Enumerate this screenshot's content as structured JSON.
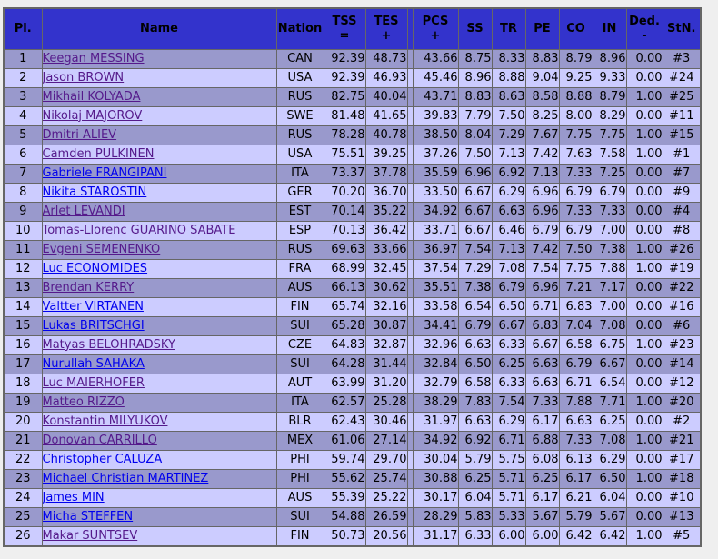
{
  "table": {
    "columns": [
      {
        "key": "pl",
        "label": "Pl.",
        "sign": ""
      },
      {
        "key": "name",
        "label": "Name",
        "sign": ""
      },
      {
        "key": "nation",
        "label": "Nation",
        "sign": ""
      },
      {
        "key": "tss",
        "label": "TSS",
        "sign": "="
      },
      {
        "key": "tes",
        "label": "TES",
        "sign": "+"
      },
      {
        "key": "pcs",
        "label": "PCS",
        "sign": "+"
      },
      {
        "key": "ss",
        "label": "SS",
        "sign": ""
      },
      {
        "key": "tr",
        "label": "TR",
        "sign": ""
      },
      {
        "key": "pe",
        "label": "PE",
        "sign": ""
      },
      {
        "key": "co",
        "label": "CO",
        "sign": ""
      },
      {
        "key": "in",
        "label": "IN",
        "sign": ""
      },
      {
        "key": "ded",
        "label": "Ded.",
        "sign": "-"
      },
      {
        "key": "stn",
        "label": "StN.",
        "sign": ""
      }
    ],
    "rows": [
      {
        "pl": "1",
        "name": "Keegan MESSING",
        "link_state": "visited",
        "nation": "CAN",
        "tss": "92.39",
        "tes": "48.73",
        "pcs": "43.66",
        "ss": "8.75",
        "tr": "8.33",
        "pe": "8.83",
        "co": "8.79",
        "in": "8.96",
        "ded": "0.00",
        "stn": "#3"
      },
      {
        "pl": "2",
        "name": "Jason BROWN",
        "link_state": "visited",
        "nation": "USA",
        "tss": "92.39",
        "tes": "46.93",
        "pcs": "45.46",
        "ss": "8.96",
        "tr": "8.88",
        "pe": "9.04",
        "co": "9.25",
        "in": "9.33",
        "ded": "0.00",
        "stn": "#24"
      },
      {
        "pl": "3",
        "name": "Mikhail KOLYADA",
        "link_state": "visited",
        "nation": "RUS",
        "tss": "82.75",
        "tes": "40.04",
        "pcs": "43.71",
        "ss": "8.83",
        "tr": "8.63",
        "pe": "8.58",
        "co": "8.88",
        "in": "8.79",
        "ded": "1.00",
        "stn": "#25"
      },
      {
        "pl": "4",
        "name": "Nikolaj MAJOROV",
        "link_state": "visited",
        "nation": "SWE",
        "tss": "81.48",
        "tes": "41.65",
        "pcs": "39.83",
        "ss": "7.79",
        "tr": "7.50",
        "pe": "8.25",
        "co": "8.00",
        "in": "8.29",
        "ded": "0.00",
        "stn": "#11"
      },
      {
        "pl": "5",
        "name": "Dmitri ALIEV",
        "link_state": "visited",
        "nation": "RUS",
        "tss": "78.28",
        "tes": "40.78",
        "pcs": "38.50",
        "ss": "8.04",
        "tr": "7.29",
        "pe": "7.67",
        "co": "7.75",
        "in": "7.75",
        "ded": "1.00",
        "stn": "#15"
      },
      {
        "pl": "6",
        "name": "Camden PULKINEN",
        "link_state": "visited",
        "nation": "USA",
        "tss": "75.51",
        "tes": "39.25",
        "pcs": "37.26",
        "ss": "7.50",
        "tr": "7.13",
        "pe": "7.42",
        "co": "7.63",
        "in": "7.58",
        "ded": "1.00",
        "stn": "#1"
      },
      {
        "pl": "7",
        "name": "Gabriele FRANGIPANI",
        "link_state": "unvisited",
        "nation": "ITA",
        "tss": "73.37",
        "tes": "37.78",
        "pcs": "35.59",
        "ss": "6.96",
        "tr": "6.92",
        "pe": "7.13",
        "co": "7.33",
        "in": "7.25",
        "ded": "0.00",
        "stn": "#7"
      },
      {
        "pl": "8",
        "name": "Nikita STAROSTIN",
        "link_state": "unvisited",
        "nation": "GER",
        "tss": "70.20",
        "tes": "36.70",
        "pcs": "33.50",
        "ss": "6.67",
        "tr": "6.29",
        "pe": "6.96",
        "co": "6.79",
        "in": "6.79",
        "ded": "0.00",
        "stn": "#9"
      },
      {
        "pl": "9",
        "name": "Arlet LEVANDI",
        "link_state": "visited",
        "nation": "EST",
        "tss": "70.14",
        "tes": "35.22",
        "pcs": "34.92",
        "ss": "6.67",
        "tr": "6.63",
        "pe": "6.96",
        "co": "7.33",
        "in": "7.33",
        "ded": "0.00",
        "stn": "#4"
      },
      {
        "pl": "10",
        "name": "Tomas-Llorenc GUARINO SABATE",
        "link_state": "visited",
        "nation": "ESP",
        "tss": "70.13",
        "tes": "36.42",
        "pcs": "33.71",
        "ss": "6.67",
        "tr": "6.46",
        "pe": "6.79",
        "co": "6.79",
        "in": "7.00",
        "ded": "0.00",
        "stn": "#8"
      },
      {
        "pl": "11",
        "name": "Evgeni SEMENENKO",
        "link_state": "visited",
        "nation": "RUS",
        "tss": "69.63",
        "tes": "33.66",
        "pcs": "36.97",
        "ss": "7.54",
        "tr": "7.13",
        "pe": "7.42",
        "co": "7.50",
        "in": "7.38",
        "ded": "1.00",
        "stn": "#26"
      },
      {
        "pl": "12",
        "name": "Luc ECONOMIDES",
        "link_state": "unvisited",
        "nation": "FRA",
        "tss": "68.99",
        "tes": "32.45",
        "pcs": "37.54",
        "ss": "7.29",
        "tr": "7.08",
        "pe": "7.54",
        "co": "7.75",
        "in": "7.88",
        "ded": "1.00",
        "stn": "#19"
      },
      {
        "pl": "13",
        "name": "Brendan KERRY",
        "link_state": "visited",
        "nation": "AUS",
        "tss": "66.13",
        "tes": "30.62",
        "pcs": "35.51",
        "ss": "7.38",
        "tr": "6.79",
        "pe": "6.96",
        "co": "7.21",
        "in": "7.17",
        "ded": "0.00",
        "stn": "#22"
      },
      {
        "pl": "14",
        "name": "Valtter VIRTANEN",
        "link_state": "unvisited",
        "nation": "FIN",
        "tss": "65.74",
        "tes": "32.16",
        "pcs": "33.58",
        "ss": "6.54",
        "tr": "6.50",
        "pe": "6.71",
        "co": "6.83",
        "in": "7.00",
        "ded": "0.00",
        "stn": "#16"
      },
      {
        "pl": "15",
        "name": "Lukas BRITSCHGI",
        "link_state": "unvisited",
        "nation": "SUI",
        "tss": "65.28",
        "tes": "30.87",
        "pcs": "34.41",
        "ss": "6.79",
        "tr": "6.67",
        "pe": "6.83",
        "co": "7.04",
        "in": "7.08",
        "ded": "0.00",
        "stn": "#6"
      },
      {
        "pl": "16",
        "name": "Matyas BELOHRADSKY",
        "link_state": "visited",
        "nation": "CZE",
        "tss": "64.83",
        "tes": "32.87",
        "pcs": "32.96",
        "ss": "6.63",
        "tr": "6.33",
        "pe": "6.67",
        "co": "6.58",
        "in": "6.75",
        "ded": "1.00",
        "stn": "#23"
      },
      {
        "pl": "17",
        "name": "Nurullah SAHAKA",
        "link_state": "unvisited",
        "nation": "SUI",
        "tss": "64.28",
        "tes": "31.44",
        "pcs": "32.84",
        "ss": "6.50",
        "tr": "6.25",
        "pe": "6.63",
        "co": "6.79",
        "in": "6.67",
        "ded": "0.00",
        "stn": "#14"
      },
      {
        "pl": "18",
        "name": "Luc MAIERHOFER",
        "link_state": "visited",
        "nation": "AUT",
        "tss": "63.99",
        "tes": "31.20",
        "pcs": "32.79",
        "ss": "6.58",
        "tr": "6.33",
        "pe": "6.63",
        "co": "6.71",
        "in": "6.54",
        "ded": "0.00",
        "stn": "#12"
      },
      {
        "pl": "19",
        "name": "Matteo RIZZO",
        "link_state": "visited",
        "nation": "ITA",
        "tss": "62.57",
        "tes": "25.28",
        "pcs": "38.29",
        "ss": "7.83",
        "tr": "7.54",
        "pe": "7.33",
        "co": "7.88",
        "in": "7.71",
        "ded": "1.00",
        "stn": "#20"
      },
      {
        "pl": "20",
        "name": "Konstantin MILYUKOV",
        "link_state": "visited",
        "nation": "BLR",
        "tss": "62.43",
        "tes": "30.46",
        "pcs": "31.97",
        "ss": "6.63",
        "tr": "6.29",
        "pe": "6.17",
        "co": "6.63",
        "in": "6.25",
        "ded": "0.00",
        "stn": "#2"
      },
      {
        "pl": "21",
        "name": "Donovan CARRILLO",
        "link_state": "visited",
        "nation": "MEX",
        "tss": "61.06",
        "tes": "27.14",
        "pcs": "34.92",
        "ss": "6.92",
        "tr": "6.71",
        "pe": "6.88",
        "co": "7.33",
        "in": "7.08",
        "ded": "1.00",
        "stn": "#21"
      },
      {
        "pl": "22",
        "name": "Christopher CALUZA",
        "link_state": "unvisited",
        "nation": "PHI",
        "tss": "59.74",
        "tes": "29.70",
        "pcs": "30.04",
        "ss": "5.79",
        "tr": "5.75",
        "pe": "6.08",
        "co": "6.13",
        "in": "6.29",
        "ded": "0.00",
        "stn": "#17"
      },
      {
        "pl": "23",
        "name": "Michael Christian MARTINEZ",
        "link_state": "unvisited",
        "nation": "PHI",
        "tss": "55.62",
        "tes": "25.74",
        "pcs": "30.88",
        "ss": "6.25",
        "tr": "5.71",
        "pe": "6.25",
        "co": "6.17",
        "in": "6.50",
        "ded": "1.00",
        "stn": "#18"
      },
      {
        "pl": "24",
        "name": "James MIN",
        "link_state": "unvisited",
        "nation": "AUS",
        "tss": "55.39",
        "tes": "25.22",
        "pcs": "30.17",
        "ss": "6.04",
        "tr": "5.71",
        "pe": "6.17",
        "co": "6.21",
        "in": "6.04",
        "ded": "0.00",
        "stn": "#10"
      },
      {
        "pl": "25",
        "name": "Micha STEFFEN",
        "link_state": "unvisited",
        "nation": "SUI",
        "tss": "54.88",
        "tes": "26.59",
        "pcs": "28.29",
        "ss": "5.83",
        "tr": "5.33",
        "pe": "5.67",
        "co": "5.79",
        "in": "5.67",
        "ded": "0.00",
        "stn": "#13"
      },
      {
        "pl": "26",
        "name": "Makar SUNTSEV",
        "link_state": "visited",
        "nation": "FIN",
        "tss": "50.73",
        "tes": "20.56",
        "pcs": "31.17",
        "ss": "6.33",
        "tr": "6.00",
        "pe": "6.00",
        "co": "6.42",
        "in": "6.42",
        "ded": "1.00",
        "stn": "#5"
      }
    ]
  },
  "colors": {
    "page_background": "#efefef",
    "header_background": "#3333cc",
    "row_odd_background": "#9999cc",
    "row_even_background": "#ccccff",
    "border": "#666666",
    "link_visited": "#551a8b",
    "link_unvisited": "#0000ee"
  }
}
